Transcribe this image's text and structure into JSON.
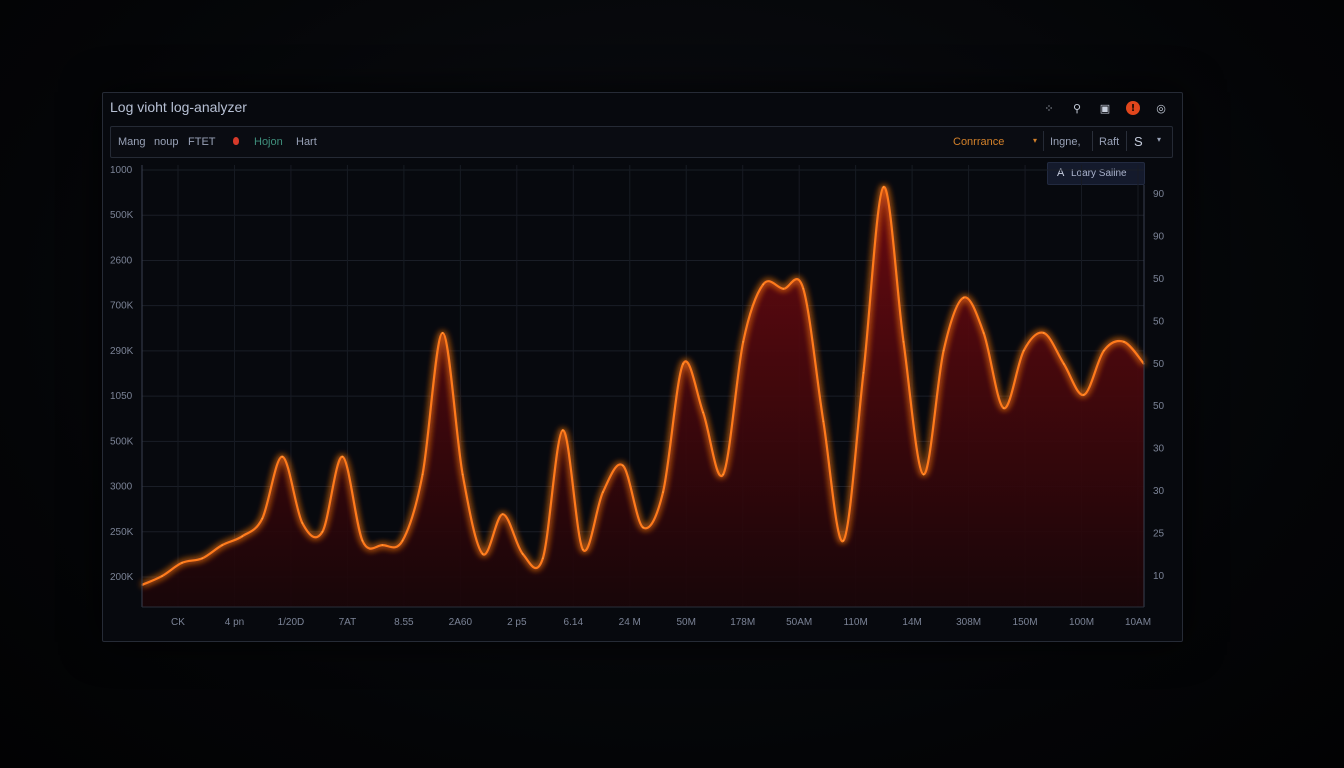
{
  "window": {
    "title": "Log vioht log-analyzer"
  },
  "top_icons": [
    {
      "name": "nodes-icon",
      "glyph": "⁘"
    },
    {
      "name": "pin-icon",
      "glyph": "⚲"
    },
    {
      "name": "camera-icon",
      "glyph": "▣"
    },
    {
      "name": "alert-icon",
      "glyph": "!"
    },
    {
      "name": "globe-icon",
      "glyph": "◎"
    }
  ],
  "toolbar": {
    "items": [
      "Mang",
      "noup",
      "FTET"
    ],
    "filters": [
      "Hojon",
      "Hart"
    ],
    "select_value": "Conrrance",
    "right_items": [
      "Ingne,",
      "Raft",
      "S"
    ]
  },
  "legend": {
    "key": "A",
    "label": "Loary Saiine"
  },
  "colors": {
    "line": "#ff7a1a",
    "glow": "#ff3a10",
    "fill": "#5c0a0e",
    "accent": "#d3812a"
  },
  "chart_data": {
    "type": "area",
    "left_axis_labels": [
      "1000",
      "500K",
      "2600",
      "700K",
      "290K",
      "1050",
      "500K",
      "3000",
      "250K",
      "200K"
    ],
    "right_axis_labels": [
      "90",
      "90",
      "50",
      "50",
      "50",
      "50",
      "30",
      "30",
      "25",
      "10"
    ],
    "x_tick_labels": [
      "CK",
      "4 pn",
      "1/20D",
      "7AT",
      "8.55",
      "2A60",
      "2 p5",
      "6.14",
      "24 M",
      "50M",
      "178M",
      "50AM",
      "110M",
      "14M",
      "308M",
      "150M",
      "100M",
      "10AM"
    ],
    "x": [
      0,
      2,
      4,
      6,
      8,
      10,
      12,
      14,
      16,
      18,
      20,
      22,
      24,
      26,
      28,
      30,
      32,
      34,
      36,
      38,
      40,
      42,
      44,
      46,
      48,
      50,
      52,
      54,
      56,
      58,
      60,
      62,
      64,
      66,
      68,
      70,
      72,
      74,
      76,
      78,
      80,
      82,
      84,
      86,
      88,
      90,
      92,
      94,
      96,
      98,
      100
    ],
    "values": [
      5,
      7,
      10,
      11,
      14,
      16,
      20,
      34,
      19,
      17,
      34,
      15,
      14,
      15,
      30,
      62,
      30,
      12,
      21,
      12,
      11,
      40,
      13,
      26,
      32,
      18,
      26,
      55,
      44,
      30,
      60,
      73,
      72,
      72,
      42,
      15,
      53,
      95,
      60,
      30,
      58,
      70,
      62,
      45,
      58,
      62,
      55,
      48,
      58,
      60,
      55
    ],
    "y_range": [
      0,
      100
    ],
    "grid": true
  }
}
